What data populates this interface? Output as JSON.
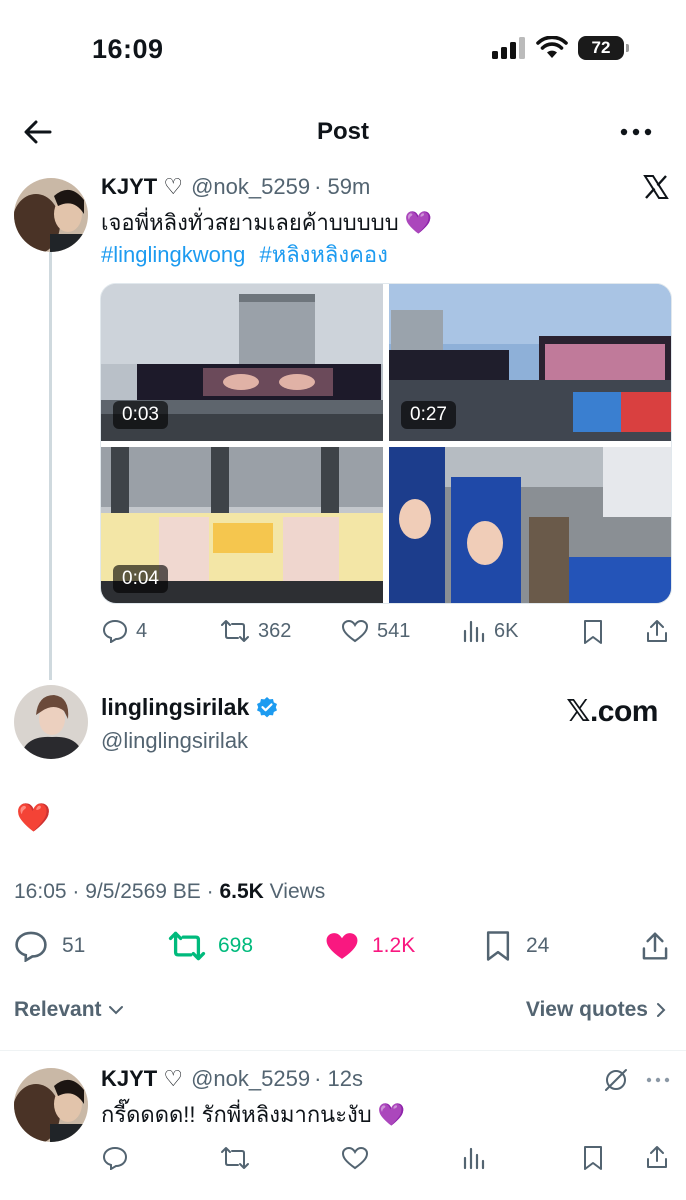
{
  "status_bar": {
    "time": "16:09",
    "battery": "72"
  },
  "header": {
    "title": "Post"
  },
  "quoted_tweet": {
    "author_name": "KJYT ♡",
    "handle": "@nok_5259",
    "time": "· 59m",
    "text": "เจอพี่หลิงทั่วสยามเลยค้าบบบบบ 💜",
    "hashtags": [
      "#linglingkwong",
      "#หลิงหลิงคอง"
    ],
    "media": [
      {
        "duration": "0:03"
      },
      {
        "duration": "0:27"
      },
      {
        "duration": "0:04"
      },
      {
        "duration": ""
      }
    ],
    "stats": {
      "replies": "4",
      "reposts": "362",
      "likes": "541",
      "views": "6K"
    }
  },
  "main_post": {
    "author_name": "linglingsirilak",
    "handle": "@linglingsirilak",
    "watermark": "𝕏.com",
    "text": "❤️",
    "timestamp": "16:05 · 9/5/2569 BE · ",
    "views_count": "6.5K",
    "views_label": " Views",
    "stats": {
      "replies": "51",
      "reposts": "698",
      "likes": "1.2K",
      "bookmarks": "24"
    },
    "accent_colors": {
      "repost": "#00ba7c",
      "like": "#f91880",
      "link": "#1d9bf0",
      "verified": "#1d9bf0"
    }
  },
  "sort": {
    "label": "Relevant",
    "view_quotes": "View quotes"
  },
  "reply": {
    "author_name": "KJYT ♡",
    "handle": "@nok_5259",
    "time": "· 12s",
    "text": "กรี๊ดดดด!! รักพี่หลิงมากนะงับ 💜"
  }
}
